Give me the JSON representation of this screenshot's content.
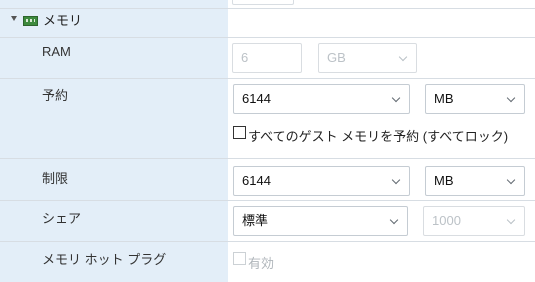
{
  "section": {
    "title": "メモリ"
  },
  "ram": {
    "label": "RAM",
    "value": "6",
    "unit": "GB"
  },
  "reservation": {
    "label": "予約",
    "value": "6144",
    "unit": "MB",
    "reserve_all_label": "すべてのゲスト メモリを予約 (すべてロック)"
  },
  "limit": {
    "label": "制限",
    "value": "6144",
    "unit": "MB"
  },
  "shares": {
    "label": "シェア",
    "value": "標準",
    "amount": "1000"
  },
  "hot_plug": {
    "label": "メモリ ホット プラグ",
    "enable_label": "有効"
  },
  "colors": {
    "sidebar": "#e3eef8",
    "border": "#d7dde3",
    "field_border": "#c5ccd3",
    "disabled_text": "#bcc2c7"
  }
}
